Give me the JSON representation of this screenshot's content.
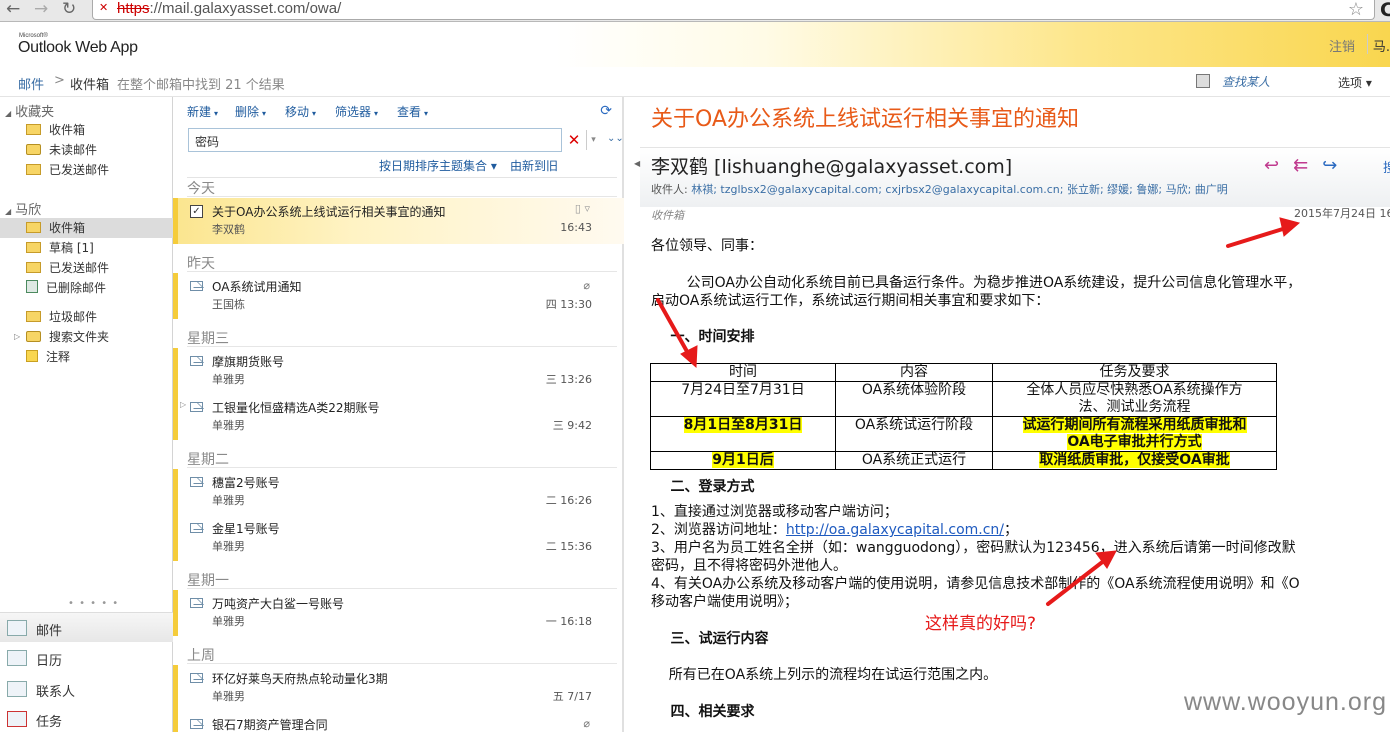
{
  "browser": {
    "url_scheme": "https",
    "url_rest": "://mail.galaxyasset.com/owa/",
    "back_icon": "back-arrow-icon",
    "forward_icon": "forward-arrow-icon",
    "reload_icon": "reload-icon",
    "bookmark_icon": "star-icon",
    "edge_letter": "C"
  },
  "header": {
    "brand_small": "Microsoft®",
    "brand": "Outlook Web App",
    "signout": "注销",
    "user_initial": "马."
  },
  "breadcrumb": {
    "mail": "邮件",
    "sep": ">",
    "inbox": "收件箱",
    "result": "在整个邮箱中找到 21 个结果",
    "find_people": "查找某人",
    "options": "选项 ▾"
  },
  "nav": {
    "favorites_title": "收藏夹",
    "favorites": [
      {
        "label": "收件箱",
        "icon": "inbox-folder-icon"
      },
      {
        "label": "未读邮件",
        "icon": "search-folder-icon"
      },
      {
        "label": "已发送邮件",
        "icon": "sent-folder-icon"
      }
    ],
    "account_title": "马欣",
    "folders": [
      {
        "label": "收件箱",
        "icon": "inbox-folder-icon",
        "selected": true
      },
      {
        "label": "草稿 [1]",
        "icon": "drafts-folder-icon"
      },
      {
        "label": "已发送邮件",
        "icon": "sent-folder-icon"
      },
      {
        "label": "已删除邮件",
        "icon": "trash-icon"
      },
      {
        "label": "垃圾邮件",
        "icon": "junk-folder-icon"
      },
      {
        "label": "搜索文件夹",
        "icon": "search-folder-icon"
      },
      {
        "label": "注释",
        "icon": "notes-icon"
      }
    ],
    "grip": "• • • • •",
    "apps": [
      {
        "label": "邮件",
        "icon": "mail-icon",
        "selected": true
      },
      {
        "label": "日历",
        "icon": "calendar-icon"
      },
      {
        "label": "联系人",
        "icon": "contacts-icon"
      },
      {
        "label": "任务",
        "icon": "tasks-icon"
      }
    ]
  },
  "toolbar": {
    "new": "新建",
    "delete": "删除",
    "move": "移动",
    "filter": "筛选器",
    "view": "查看",
    "refresh_icon": "refresh-icon"
  },
  "search": {
    "value": "密码",
    "clear_icon": "clear-search-icon",
    "options_icon": "search-options-icon",
    "expand_icon": "expand-search-icon"
  },
  "sort": {
    "by": "按日期排序主题集合 ▾",
    "order": "由新到旧"
  },
  "messages": {
    "groups": [
      "今天",
      "昨天",
      "星期三",
      "星期二",
      "星期一",
      "上周"
    ],
    "items": [
      {
        "subject": "关于OA办公系统上线试运行相关事宜的通知",
        "from": "李双鹤",
        "time": "16:43",
        "selected": true
      },
      {
        "subject": "OA系统试用通知",
        "from": "王国栋",
        "time": "四 13:30",
        "attachment": true
      },
      {
        "subject": "摩旗期货账号",
        "from": "单雅男",
        "time": "三 13:26"
      },
      {
        "subject": "工银量化恒盛精选A类22期账号",
        "from": "单雅男",
        "time": "三 9:42"
      },
      {
        "subject": "穗富2号账号",
        "from": "单雅男",
        "time": "二 16:26"
      },
      {
        "subject": "金星1号账号",
        "from": "单雅男",
        "time": "二 15:36"
      },
      {
        "subject": "万吨资产大白鲨一号账号",
        "from": "单雅男",
        "time": "一 16:18"
      },
      {
        "subject": "环亿好莱鸟天府热点轮动量化3期",
        "from": "单雅男",
        "time": "五 7/17"
      },
      {
        "subject": "银石7期资产管理合同",
        "from": "",
        "time": "",
        "attachment": true
      }
    ]
  },
  "reading": {
    "title": "关于OA办公系统上线试运行相关事宜的通知",
    "sender": "李双鹤 [lishuanghe@galaxyasset.com]",
    "to_label": "收件人:",
    "to_names": "林祺; tzglbsx2@galaxycapital.com; cxjrbsx2@galaxycapital.com.cn; 张立新; 缪媛; 鲁娜; 马欣; 曲广明",
    "folder": "收件箱",
    "date": "2015年7月24日 16",
    "reply_icon": "reply-icon",
    "reply_all_icon": "reply-all-icon",
    "forward_icon": "forward-icon",
    "more": "搜",
    "greeting": "各位领导、同事：",
    "intro1": "        公司OA办公自动化系统目前已具备运行条件。为稳步推进OA系统建设，提升公司信息化管理水平，",
    "intro2": "启动OA系统试运行工作，系统试运行期间相关事宜和要求如下：",
    "sec1": "    一、时间安排",
    "table": {
      "headers": [
        "时间",
        "内容",
        "任务及要求"
      ],
      "rows": [
        {
          "time": "7月24日至7月31日",
          "content": "OA系统体验阶段",
          "task1": "全体人员应尽快熟悉OA系统操作方",
          "task2": "法、测试业务流程",
          "hl": false
        },
        {
          "time": "8月1日至8月31日",
          "content": "OA系统试运行阶段",
          "task1": "试运行期间所有流程采用纸质审批和",
          "task2": "OA电子审批并行方式",
          "hl": true
        },
        {
          "time": "9月1日后",
          "content": "OA系统正式运行",
          "task1": "取消纸质审批，仅接受OA审批",
          "task2": "",
          "hl": true
        }
      ]
    },
    "sec2": "    二、登录方式",
    "l1": "1、直接通过浏览器或移动客户端访问；",
    "l2a": "2、浏览器访问地址：",
    "l2link": "http://oa.galaxycapital.com.cn/",
    "l2b": "；",
    "l3a": "3、用户名为员工姓名全拼（如：wangguodong），密码默认为123456，进入系统后请第一时间修改默",
    "l3b": "密码，且不得将密码外泄他人。",
    "l4a": "4、有关OA办公系统及移动客户端的使用说明，请参见信息技术部制作的《OA系统流程使用说明》和《O",
    "l4b": "移动客户端使用说明》；",
    "sec3": "    三、试运行内容",
    "p3": "    所有已在OA系统上列示的流程均在试运行范围之内。",
    "sec4": "    四、相关要求"
  },
  "annotation": "这样真的好吗?",
  "watermark": "www.wooyun.org",
  "colors": {
    "title": "#e85a18",
    "annotation": "#e61a1a",
    "highlight": "#ffff00",
    "link": "#1f5bc0"
  }
}
